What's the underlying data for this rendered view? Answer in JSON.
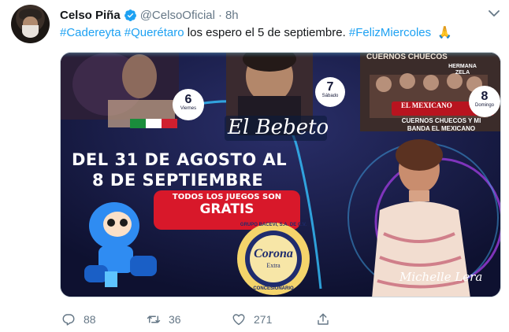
{
  "tweet": {
    "author_name": "Celso Piña",
    "handle": "@CelsoOficial",
    "separator": "·",
    "time": "8h",
    "text_parts": {
      "tag1": "#Cadereyta",
      "tag2": "#Querétaro",
      "body": "los espero el 5 de septiembre.",
      "tag3": "#FelizMiercoles",
      "emoji": "🙏"
    }
  },
  "poster": {
    "band_name": "CUERNOS CHUECOS",
    "top_right_caption": "HERMANA ZELA",
    "badge_6_day": "6",
    "badge_6_label": "Viernes",
    "badge_7_day": "7",
    "badge_7_label": "Sábado",
    "badge_8_day": "8",
    "badge_8_label": "Domingo",
    "singer_name": "El Bebeto",
    "band_banner": "EL MEXICANO",
    "band_tagline": "CUERNOS CHUECOS Y MI BANDA EL MEXICANO",
    "dates_line1": "DEL 31 DE AGOSTO AL",
    "dates_line2": "8 DE SEPTIEMBRE",
    "games_line1": "TODOS LOS JUEGOS SON",
    "games_line2": "GRATIS",
    "sponsor_ring_top": "GRUPO BACEVI, S.A. DE C.V.",
    "sponsor_brand": "Corona",
    "sponsor_sub": "Extra",
    "sponsor_ring_bottom": "CONCESIONARIO",
    "artist_signature": "Michelle Lera"
  },
  "actions": {
    "reply_count": "88",
    "retweet_count": "36",
    "like_count": "271"
  },
  "colors": {
    "link": "#1da1f2",
    "muted": "#657786",
    "poster_bg": "#141838",
    "games_red": "#d8182a"
  }
}
